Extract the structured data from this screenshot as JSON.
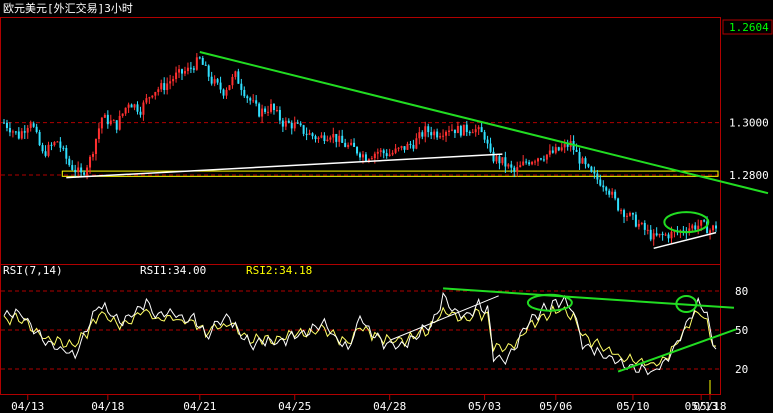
{
  "header": {
    "title": "欧元美元[外汇交易]3小时",
    "current_price": "1.2604"
  },
  "rsi_header": {
    "label": "RSI(7,14)",
    "rsi1": "RSI1:34.00",
    "rsi2": "RSI2:34.18"
  },
  "colors": {
    "background": "#000000",
    "frame": "#b00000",
    "grid": "#b00000",
    "candle_up": "#ff3030",
    "candle_down": "#30e0ff",
    "trend_green": "#22dd22",
    "trend_white": "#ffffff",
    "zone_yellow": "#ffff00",
    "rsi1_line": "#ffffff",
    "rsi2_line": "#ffff66",
    "axis_text": "#ffffff",
    "title_text": "#ffffff",
    "current_price_text": "#00ff00"
  },
  "chart_data": [
    {
      "type": "candlestick",
      "title": "欧元美元[外汇交易]3小时",
      "x_ticks": [
        "04/13",
        "04/18",
        "04/21",
        "04/25",
        "04/28",
        "05/03",
        "05/06",
        "05/10",
        "05/13",
        "05/18"
      ],
      "y_ticks": [
        "1.3000",
        "1.2800"
      ],
      "y_range": [
        1.246,
        1.34
      ],
      "current_price": 1.2604,
      "support_zone": [
        1.2795,
        1.2815
      ],
      "anchors": [
        [
          0,
          1.3
        ],
        [
          5,
          1.295
        ],
        [
          9,
          1.301
        ],
        [
          13,
          1.288
        ],
        [
          18,
          1.293
        ],
        [
          22,
          1.284
        ],
        [
          26,
          1.28
        ],
        [
          29,
          1.286
        ],
        [
          33,
          1.302
        ],
        [
          38,
          1.299
        ],
        [
          42,
          1.308
        ],
        [
          46,
          1.305
        ],
        [
          50,
          1.312
        ],
        [
          54,
          1.314
        ],
        [
          58,
          1.318
        ],
        [
          62,
          1.32
        ],
        [
          66,
          1.324
        ],
        [
          70,
          1.316
        ],
        [
          74,
          1.312
        ],
        [
          78,
          1.318
        ],
        [
          82,
          1.31
        ],
        [
          86,
          1.304
        ],
        [
          90,
          1.306
        ],
        [
          94,
          1.3
        ],
        [
          98,
          1.299
        ],
        [
          102,
          1.296
        ],
        [
          106,
          1.294
        ],
        [
          110,
          1.296
        ],
        [
          114,
          1.292
        ],
        [
          118,
          1.29
        ],
        [
          122,
          1.287
        ],
        [
          126,
          1.289
        ],
        [
          130,
          1.288
        ],
        [
          134,
          1.29
        ],
        [
          138,
          1.292
        ],
        [
          142,
          1.297
        ],
        [
          146,
          1.296
        ],
        [
          150,
          1.298
        ],
        [
          154,
          1.297
        ],
        [
          158,
          1.298
        ],
        [
          162,
          1.295
        ],
        [
          164,
          1.287
        ],
        [
          168,
          1.285
        ],
        [
          172,
          1.281
        ],
        [
          176,
          1.285
        ],
        [
          180,
          1.287
        ],
        [
          184,
          1.288
        ],
        [
          188,
          1.29
        ],
        [
          191,
          1.292
        ],
        [
          194,
          1.286
        ],
        [
          198,
          1.28
        ],
        [
          203,
          1.276
        ],
        [
          207,
          1.268
        ],
        [
          211,
          1.264
        ],
        [
          215,
          1.26
        ],
        [
          219,
          1.256
        ],
        [
          223,
          1.257
        ],
        [
          227,
          1.258
        ],
        [
          231,
          1.26
        ],
        [
          235,
          1.261
        ],
        [
          238,
          1.259
        ],
        [
          240,
          1.2604
        ]
      ],
      "trendlines": [
        {
          "name": "resistance",
          "from": [
            66,
            1.327
          ],
          "to": [
            240,
            1.278
          ]
        },
        {
          "name": "support",
          "from": [
            21,
            1.279
          ],
          "to": [
            168,
            1.288
          ]
        },
        {
          "name": "short_support",
          "from": [
            219,
            1.252
          ],
          "to": [
            240,
            1.258
          ]
        }
      ],
      "highlight_ellipses": [
        {
          "center": [
            230,
            1.262
          ]
        }
      ]
    },
    {
      "type": "line",
      "title": "RSI(7,14)",
      "series": [
        {
          "name": "RSI1",
          "last": 34.0
        },
        {
          "name": "RSI2",
          "last": 34.18
        }
      ],
      "y_ticks": [
        80,
        50,
        20
      ],
      "y_range": [
        0,
        100
      ],
      "anchors_rsi1": [
        [
          0,
          60
        ],
        [
          4,
          65
        ],
        [
          8,
          58
        ],
        [
          12,
          45
        ],
        [
          16,
          40
        ],
        [
          20,
          35
        ],
        [
          24,
          30
        ],
        [
          28,
          50
        ],
        [
          32,
          70
        ],
        [
          36,
          62
        ],
        [
          40,
          55
        ],
        [
          44,
          65
        ],
        [
          48,
          72
        ],
        [
          52,
          60
        ],
        [
          56,
          65
        ],
        [
          60,
          58
        ],
        [
          64,
          60
        ],
        [
          68,
          45
        ],
        [
          72,
          55
        ],
        [
          76,
          60
        ],
        [
          80,
          45
        ],
        [
          84,
          38
        ],
        [
          88,
          42
        ],
        [
          92,
          40
        ],
        [
          96,
          44
        ],
        [
          100,
          48
        ],
        [
          104,
          50
        ],
        [
          108,
          55
        ],
        [
          112,
          42
        ],
        [
          116,
          35
        ],
        [
          120,
          60
        ],
        [
          124,
          48
        ],
        [
          128,
          40
        ],
        [
          132,
          38
        ],
        [
          136,
          40
        ],
        [
          140,
          48
        ],
        [
          144,
          55
        ],
        [
          148,
          75
        ],
        [
          152,
          65
        ],
        [
          156,
          60
        ],
        [
          160,
          70
        ],
        [
          163,
          65
        ],
        [
          165,
          30
        ],
        [
          169,
          28
        ],
        [
          173,
          40
        ],
        [
          177,
          55
        ],
        [
          181,
          65
        ],
        [
          185,
          70
        ],
        [
          189,
          72
        ],
        [
          192,
          65
        ],
        [
          195,
          40
        ],
        [
          199,
          35
        ],
        [
          203,
          30
        ],
        [
          207,
          25
        ],
        [
          211,
          22
        ],
        [
          215,
          20
        ],
        [
          219,
          18
        ],
        [
          223,
          25
        ],
        [
          227,
          40
        ],
        [
          231,
          60
        ],
        [
          234,
          72
        ],
        [
          237,
          60
        ],
        [
          240,
          34
        ]
      ],
      "anchors_rsi2": [
        [
          0,
          58
        ],
        [
          4,
          60
        ],
        [
          8,
          55
        ],
        [
          12,
          47
        ],
        [
          16,
          43
        ],
        [
          20,
          40
        ],
        [
          24,
          38
        ],
        [
          28,
          48
        ],
        [
          32,
          62
        ],
        [
          36,
          58
        ],
        [
          40,
          54
        ],
        [
          44,
          60
        ],
        [
          48,
          65
        ],
        [
          52,
          58
        ],
        [
          56,
          60
        ],
        [
          60,
          56
        ],
        [
          64,
          57
        ],
        [
          68,
          48
        ],
        [
          72,
          52
        ],
        [
          76,
          55
        ],
        [
          80,
          47
        ],
        [
          84,
          42
        ],
        [
          88,
          44
        ],
        [
          92,
          42
        ],
        [
          96,
          45
        ],
        [
          100,
          47
        ],
        [
          104,
          48
        ],
        [
          108,
          52
        ],
        [
          112,
          44
        ],
        [
          116,
          40
        ],
        [
          120,
          54
        ],
        [
          124,
          47
        ],
        [
          128,
          43
        ],
        [
          132,
          41
        ],
        [
          136,
          42
        ],
        [
          140,
          47
        ],
        [
          144,
          52
        ],
        [
          148,
          66
        ],
        [
          152,
          60
        ],
        [
          156,
          57
        ],
        [
          160,
          63
        ],
        [
          163,
          60
        ],
        [
          165,
          38
        ],
        [
          169,
          35
        ],
        [
          173,
          42
        ],
        [
          177,
          52
        ],
        [
          181,
          60
        ],
        [
          185,
          64
        ],
        [
          189,
          66
        ],
        [
          192,
          60
        ],
        [
          195,
          45
        ],
        [
          199,
          40
        ],
        [
          203,
          35
        ],
        [
          207,
          30
        ],
        [
          211,
          27
        ],
        [
          215,
          25
        ],
        [
          219,
          23
        ],
        [
          223,
          28
        ],
        [
          227,
          40
        ],
        [
          231,
          55
        ],
        [
          234,
          65
        ],
        [
          237,
          56
        ],
        [
          240,
          34
        ]
      ],
      "trendlines": [
        {
          "name": "rsi_top",
          "from": [
            148,
            82
          ],
          "to": [
            240,
            68
          ]
        },
        {
          "name": "rsi_left_support",
          "from": [
            130,
            42
          ],
          "to": [
            160,
            70
          ]
        },
        {
          "name": "rsi_right_support",
          "from": [
            207,
            18
          ],
          "to": [
            240,
            45
          ]
        }
      ],
      "highlight_ellipses": [
        {
          "center": [
            184,
            71
          ]
        },
        {
          "center": [
            230,
            70
          ]
        }
      ]
    }
  ]
}
